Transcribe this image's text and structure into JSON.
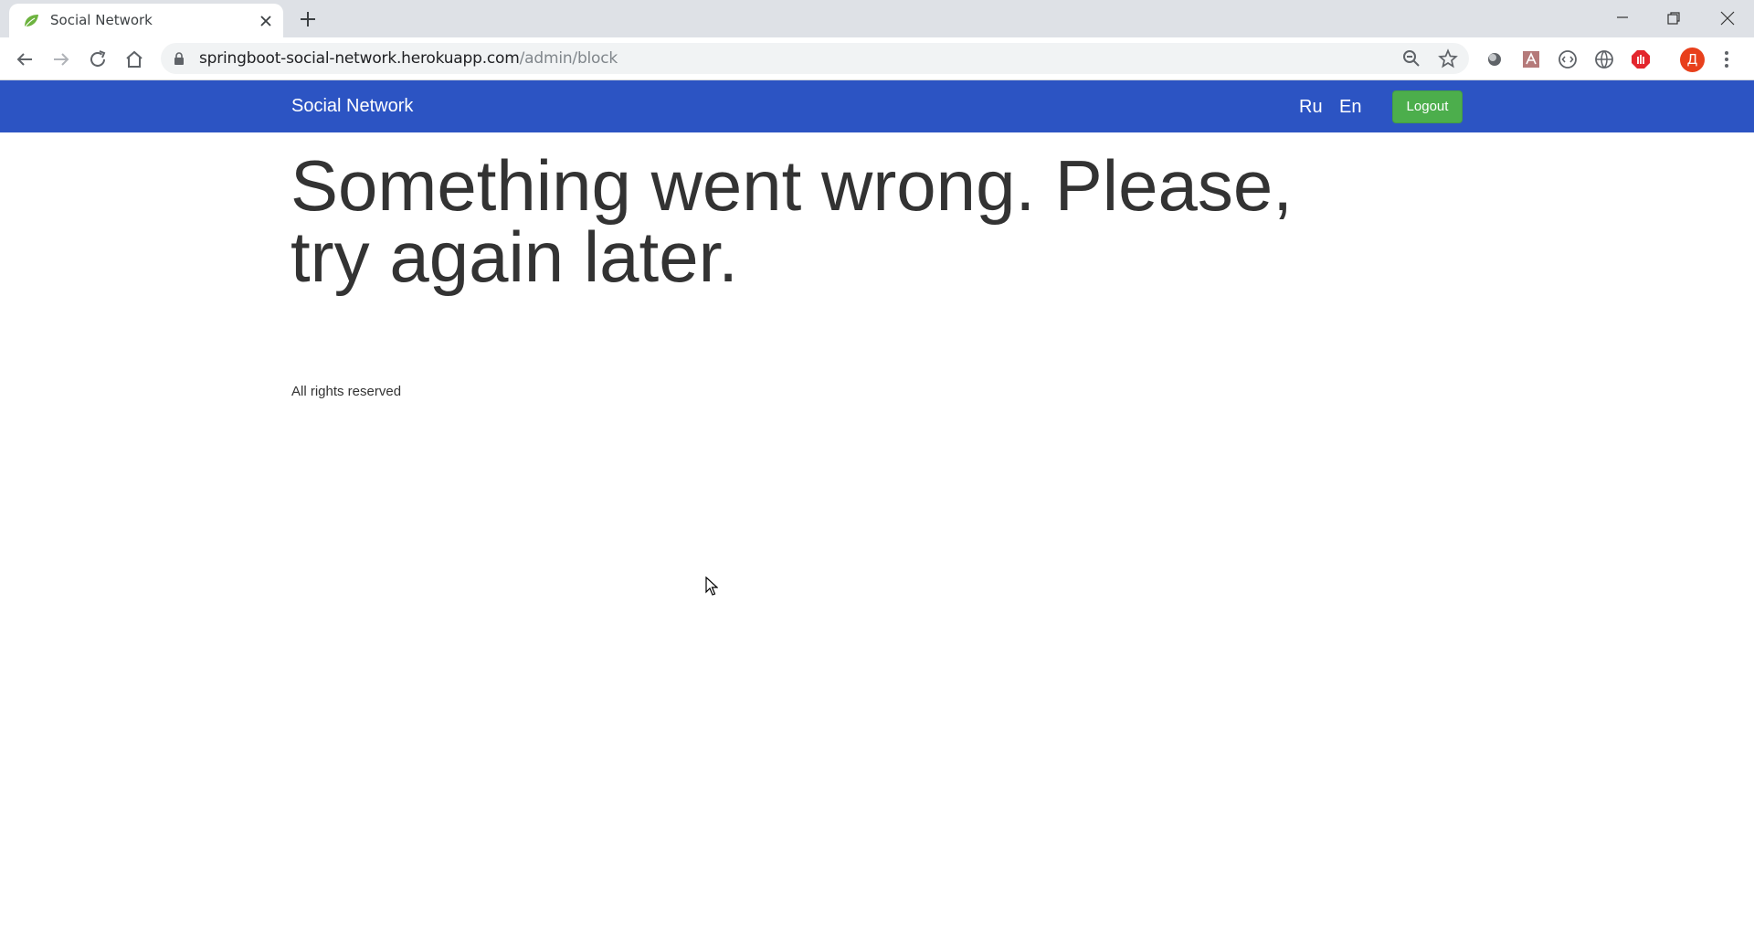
{
  "browser": {
    "tab": {
      "title": "Social Network",
      "favicon": "spring-leaf-icon"
    },
    "address_bar": {
      "host": "springboot-social-network.herokuapp.com",
      "path": "/admin/block"
    },
    "profile_initial": "Д",
    "icons": {
      "back": "back-arrow-icon",
      "forward": "forward-arrow-icon",
      "reload": "reload-icon",
      "home": "home-icon",
      "zoom": "zoom-icon",
      "bookmark": "star-icon"
    }
  },
  "page": {
    "navbar": {
      "brand": "Social Network",
      "languages": [
        "Ru",
        "En"
      ],
      "logout_label": "Logout"
    },
    "error_message": "Something went wrong. Please, try again later.",
    "footer": "All rights reserved"
  },
  "colors": {
    "navbar_bg": "#2c54c3",
    "logout_bg": "#4cae4c",
    "text": "#333333"
  }
}
